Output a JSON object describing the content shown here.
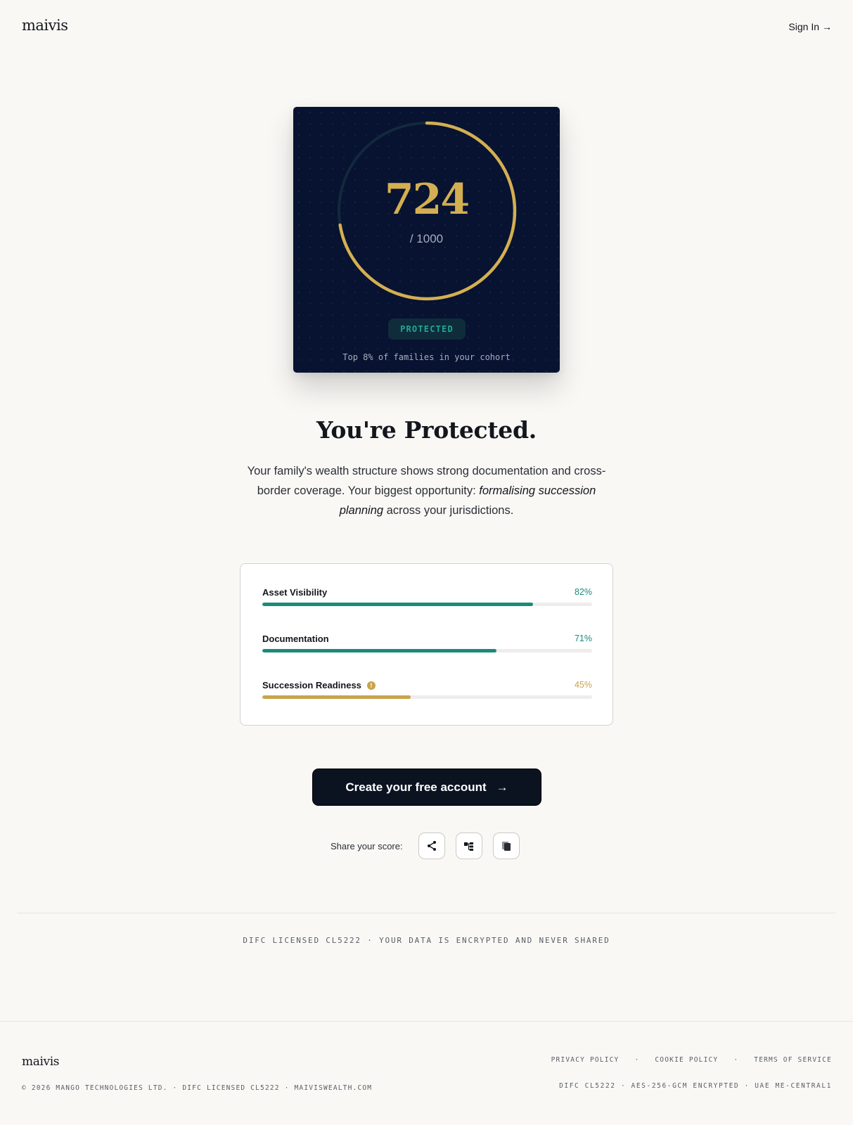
{
  "header": {
    "logo": "maivis",
    "sign_in": "Sign In",
    "sign_in_arrow": "→"
  },
  "score_card": {
    "score": "724",
    "max": "/ 1000",
    "score_fraction": 0.724,
    "status": "PROTECTED",
    "cohort_text": "Top 8% of families in your cohort",
    "colors": {
      "background": "#071331",
      "ring": "#d4af52",
      "ring_track": "#13283c",
      "status": "#1fa896"
    }
  },
  "headline": "You're Protected.",
  "description": {
    "part1": "Your family's wealth structure shows strong documentation and cross-border coverage. Your biggest opportunity: ",
    "emphasis": "formalising succession planning",
    "part2": " across your jurisdictions."
  },
  "metrics": [
    {
      "label": "Asset Visibility",
      "value": "82%",
      "fraction": 0.82,
      "color": "#1b8a7a",
      "has_info": false
    },
    {
      "label": "Documentation",
      "value": "71%",
      "fraction": 0.71,
      "color": "#1b8a7a",
      "has_info": false
    },
    {
      "label": "Succession Readiness",
      "value": "45%",
      "fraction": 0.45,
      "color": "#c8a34c",
      "has_info": true,
      "info_icon": "!"
    }
  ],
  "cta": {
    "label": "Create your free account",
    "arrow": "→"
  },
  "share": {
    "label": "Share your score:",
    "buttons": [
      {
        "icon": "share-icon"
      },
      {
        "icon": "linkedin-icon"
      },
      {
        "icon": "copy-icon"
      }
    ]
  },
  "trust_line": "DIFC LICENSED CL5222 · YOUR DATA IS ENCRYPTED AND NEVER SHARED",
  "footer": {
    "logo": "maivis",
    "copyright": "© 2026 MANGO TECHNOLOGIES LTD. · DIFC LICENSED CL5222 · MAIVISWEALTH.COM",
    "links": [
      "PRIVACY POLICY",
      "COOKIE POLICY",
      "TERMS OF SERVICE"
    ],
    "separator": "·",
    "security": "DIFC CL5222 · AES-256-GCM ENCRYPTED · UAE ME-CENTRAL1"
  }
}
